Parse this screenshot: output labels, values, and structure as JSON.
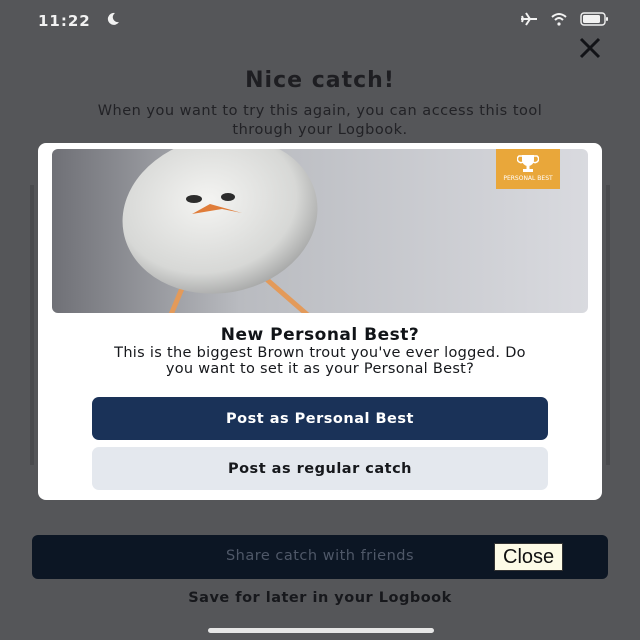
{
  "status_bar": {
    "time": "11:22",
    "icons": [
      "moon-icon",
      "airplane-icon",
      "wifi-icon",
      "battery-icon"
    ]
  },
  "background": {
    "title": "Nice catch!",
    "subtitle": "When you want to try this again, you can access this tool through your Logbook.",
    "share_label": "Share catch with friends",
    "close_label": "Close",
    "save_link": "Save for later in your Logbook"
  },
  "modal": {
    "badge_text": "PERSONAL BEST",
    "title": "New Personal Best?",
    "body": "This is the biggest Brown trout you've ever logged. Do you want to set it as your Personal Best?",
    "primary_label": "Post as Personal Best",
    "secondary_label": "Post as regular catch"
  },
  "colors": {
    "overlay": "#555659",
    "primary": "#1a3258",
    "secondary": "#e4e8ee",
    "badge": "#e9a73a"
  }
}
